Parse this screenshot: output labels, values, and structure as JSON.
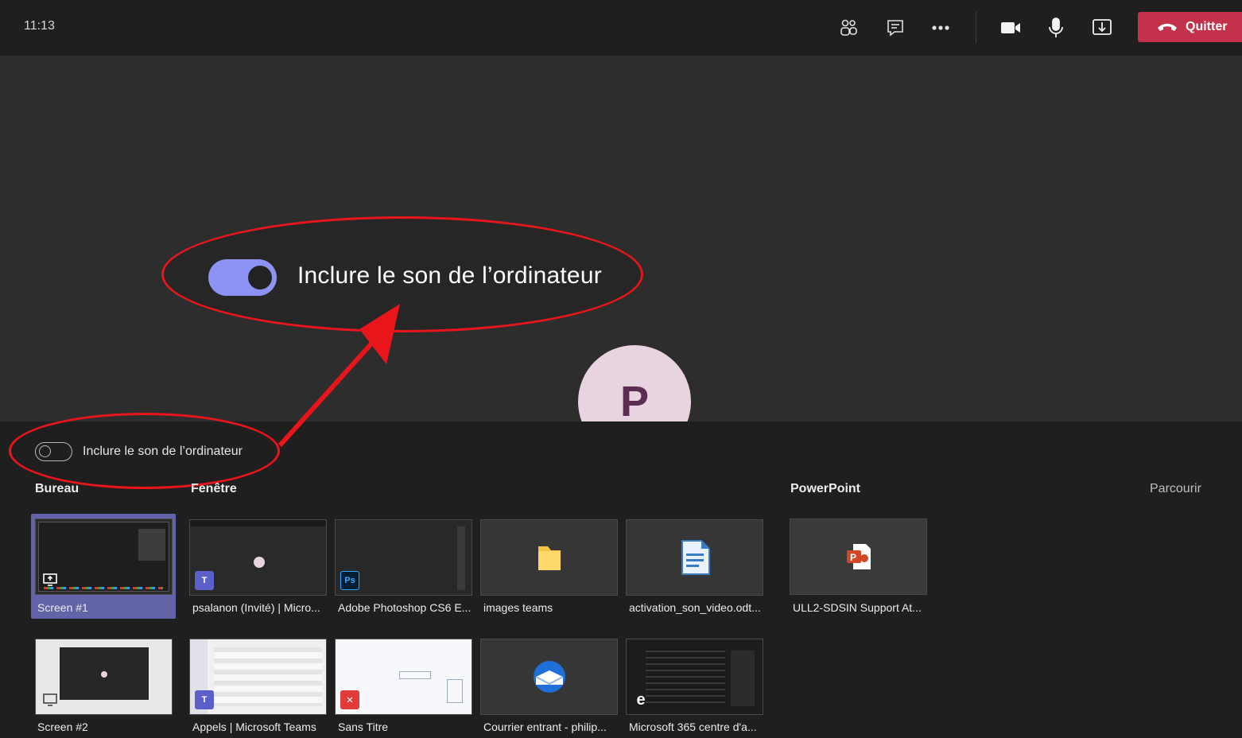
{
  "topbar": {
    "time": "11:13",
    "leave_label": "Quitter",
    "icons": [
      "participants-icon",
      "chat-icon",
      "more-options-icon",
      "camera-icon",
      "microphone-icon",
      "share-tray-icon",
      "hang-up-icon"
    ]
  },
  "stage": {
    "avatar_initial": "P",
    "zoomed_toggle_label": "Inclure le son de l’ordinateur",
    "zoomed_toggle_state": "on"
  },
  "tray": {
    "include_sound_label": "Inclure le son de l’ordinateur",
    "include_sound_state": "off",
    "sections": {
      "desktop": "Bureau",
      "window": "Fenêtre",
      "powerpoint": "PowerPoint",
      "browse": "Parcourir"
    },
    "screens": [
      {
        "label": "Screen #1",
        "selected": true
      },
      {
        "label": "Screen #2",
        "selected": false
      }
    ],
    "windows": [
      {
        "label": "psalanon (Invité) | Micro...",
        "icon": "teams-icon"
      },
      {
        "label": "Adobe Photoshop CS6 E...",
        "icon": "photoshop-icon"
      },
      {
        "label": "images teams",
        "icon": "folder-icon"
      },
      {
        "label": "activation_son_video.odt...",
        "icon": "document-icon"
      },
      {
        "label": "Appels | Microsoft Teams",
        "icon": "teams-icon"
      },
      {
        "label": "Sans Titre",
        "icon": "xmind-icon"
      },
      {
        "label": "Courrier entrant - philip...",
        "icon": "thunderbird-icon"
      },
      {
        "label": "Microsoft 365 centre d'a...",
        "icon": "edge-icon"
      }
    ],
    "presentations": [
      {
        "label": "ULL2-SDSIN Support At...",
        "icon": "powerpoint-icon"
      }
    ]
  },
  "colors": {
    "accent": "#6264a7",
    "toggle_on": "#8d93f4",
    "leave": "#c4314b",
    "annotation": "#e8151b"
  }
}
